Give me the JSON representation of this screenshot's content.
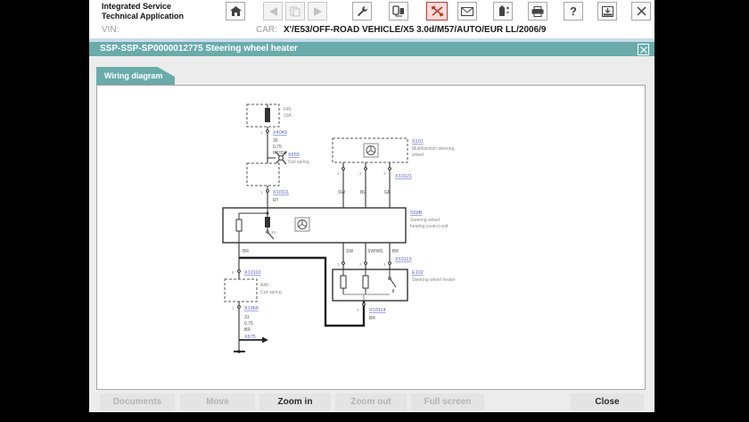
{
  "app": {
    "title_line1": "Integrated Service",
    "title_line2": "Technical Application"
  },
  "toolbar": {
    "help_glyph": "?",
    "icons": [
      {
        "name": "home-icon",
        "state": "enabled"
      },
      {
        "name": "back-icon",
        "state": "disabled"
      },
      {
        "name": "pages-icon",
        "state": "disabled"
      },
      {
        "name": "forward-icon",
        "state": "disabled"
      },
      {
        "name": "wrench-icon",
        "state": "enabled"
      },
      {
        "name": "devices-icon",
        "state": "enabled"
      },
      {
        "name": "measurement-icon",
        "state": "active-red"
      },
      {
        "name": "envelope-icon",
        "state": "enabled"
      },
      {
        "name": "battery-icon",
        "state": "enabled"
      },
      {
        "name": "printer-icon",
        "state": "enabled"
      },
      {
        "name": "help-icon",
        "state": "enabled"
      },
      {
        "name": "tray-icon",
        "state": "enabled"
      },
      {
        "name": "close-icon",
        "state": "enabled"
      }
    ]
  },
  "vehicle": {
    "vin_label": "VIN:",
    "car_label": "CAR:",
    "car_value": "X'/E53/OFF-ROAD VEHICLE/X5 3.0d/M57/AUTO/EUR LL/2006/9"
  },
  "document": {
    "title": "SSP-SSP-SP0000012775 Steering wheel heater",
    "close_glyph": "×"
  },
  "tabs": {
    "wiring": "Wiring diagram"
  },
  "buttons": {
    "documents": "Documents",
    "move": "Move",
    "zoom_in": "Zoom in",
    "zoom_out": "Zoom out",
    "full_screen": "Full screen",
    "close": "Close"
  },
  "colors": {
    "teal": "#6aabab",
    "link_blue": "#5862c8",
    "highlight_red": "#c0392b"
  },
  "diagram": {
    "fuse_ref": "F45",
    "fuse_amp": "10A",
    "pin_1a": "1",
    "conn_x4049": "X4049",
    "w1_circuit": "30",
    "w1_gauge": "0,75",
    "w1_color": "RT/SW",
    "splice_ref": "X655",
    "splice_name": "Coil spring",
    "pin_1b": "1",
    "conn_x10111": "X10111",
    "w2_color": "RT",
    "cu_ref": "S50B",
    "cu_name1": "Steering wheel",
    "cu_name2": "heating control unit",
    "cu_term": "30",
    "mfl_ref": "S101",
    "mfl_name1": "Multifunction steering",
    "mfl_name2": "wheel",
    "mfl_pin1": "1",
    "mfl_pin2": "2",
    "mfl_pin3": "3",
    "conn_x10121": "X10121",
    "mfl_w1": "SW",
    "mfl_w2": "BL",
    "mfl_w3": "GB",
    "low_w0": "BR",
    "low_w1": "SW",
    "low_w2": "SW/WS",
    "low_w3": "BR",
    "low_pin1": "1",
    "low_pin2": "2",
    "low_pin3": "3",
    "conn_x10113": "X10113",
    "ht_ref": "E102",
    "ht_name": "Steering wheel heater",
    "ht_pin": "4",
    "conn_x10114": "X10114",
    "ht_wire": "BR",
    "cs_pin_top": "4",
    "conn_x10110": "X10110",
    "cs_ref": "A40",
    "cs_name": "Coil spring",
    "cs_pin_bot": "1",
    "conn_x1066": "X1066",
    "gw_circuit": "31",
    "gw_gauge": "0,75",
    "gw_color": "BR",
    "arrow_ref": "X675"
  }
}
